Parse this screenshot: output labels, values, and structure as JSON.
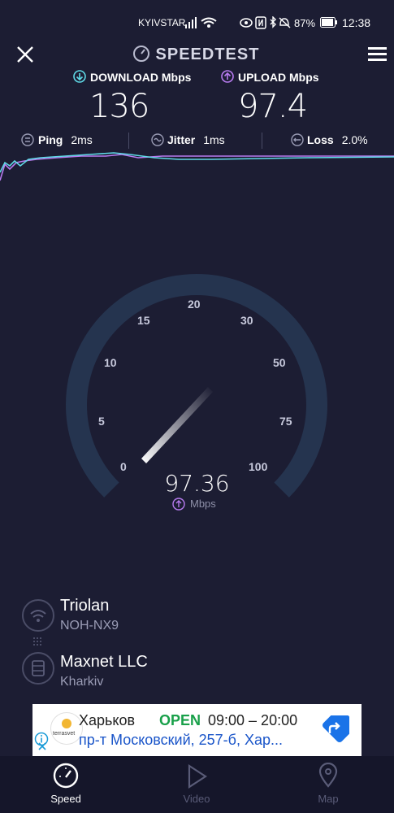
{
  "status": {
    "carrier": "KYIVSTAR",
    "battery": "87%",
    "time": "12:38"
  },
  "header": {
    "title": "SPEEDTEST"
  },
  "download": {
    "label": "DOWNLOAD Mbps",
    "value": "136"
  },
  "upload": {
    "label": "UPLOAD Mbps",
    "value": "97.4"
  },
  "metrics": {
    "ping": {
      "label": "Ping",
      "value": "2ms"
    },
    "jitter": {
      "label": "Jitter",
      "value": "1ms"
    },
    "loss": {
      "label": "Loss",
      "value": "2.0%"
    }
  },
  "gauge": {
    "ticks": [
      "0",
      "5",
      "10",
      "15",
      "20",
      "30",
      "50",
      "75",
      "100"
    ],
    "value": "97.36",
    "unit": "Mbps"
  },
  "provider": {
    "name": "Triolan",
    "device": "NOH-NX9"
  },
  "server": {
    "name": "Maxnet LLC",
    "city": "Kharkiv"
  },
  "ad": {
    "logo_text": "terrasvet",
    "name": "Харьков",
    "status": "OPEN",
    "hours": "09:00 – 20:00",
    "address": "пр-т Московский, 257-б, Хар..."
  },
  "nav": [
    {
      "label": "Speed",
      "active": true
    },
    {
      "label": "Video",
      "active": false
    },
    {
      "label": "Map",
      "active": false
    }
  ],
  "colors": {
    "background": "#1c1d33",
    "download": "#5fd9e6",
    "upload": "#b77bef",
    "accent_blue": "#1a73e8"
  }
}
